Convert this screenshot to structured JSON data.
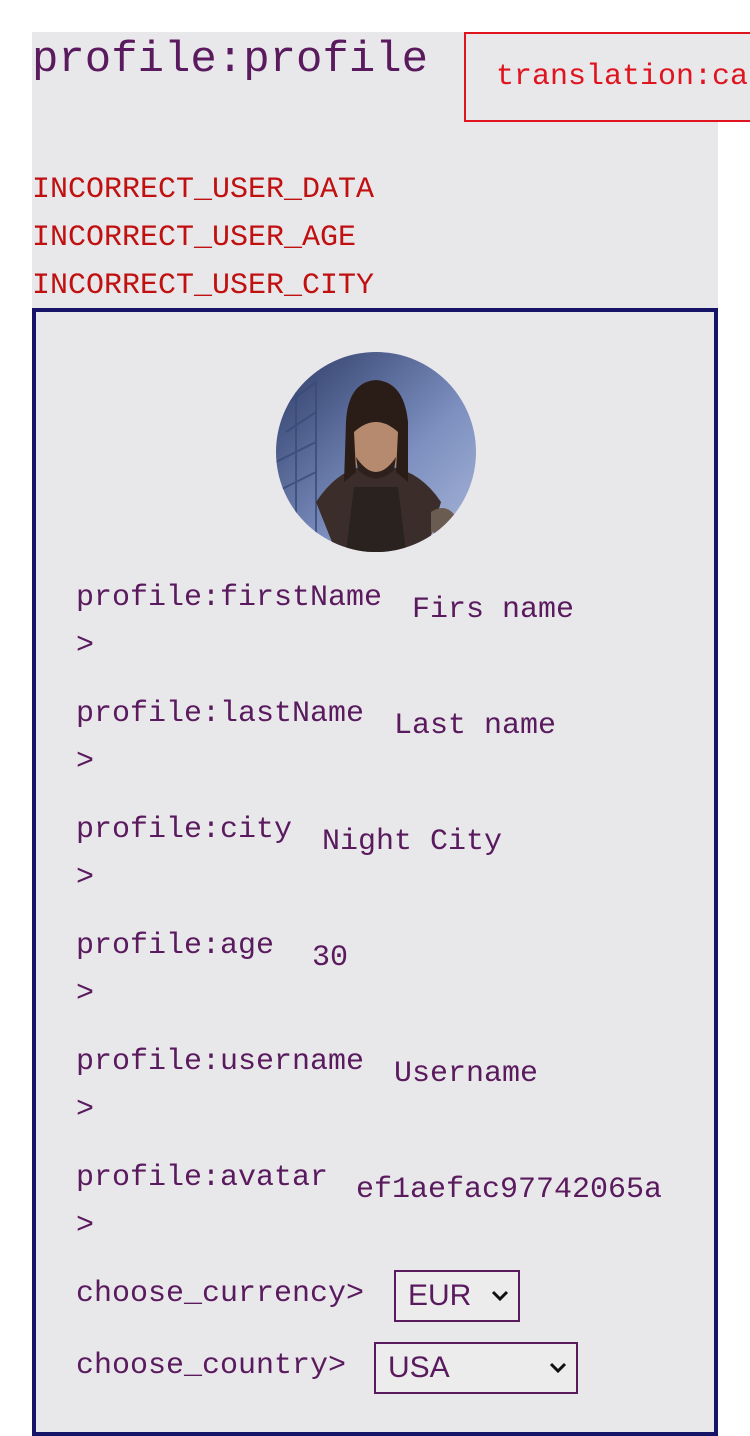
{
  "header": {
    "title": "profile:profile",
    "edit_button_label": "translation:cancel"
  },
  "errors": [
    "INCORRECT_USER_DATA",
    "INCORRECT_USER_AGE",
    "INCORRECT_USER_CITY"
  ],
  "form": {
    "fields": [
      {
        "label": "profile:firstName\n>",
        "value": "Firs name"
      },
      {
        "label": "profile:lastName\n>",
        "value": "Last name"
      },
      {
        "label": "profile:city\n>",
        "value": "Night City"
      },
      {
        "label": "profile:age\n>",
        "value": "30"
      },
      {
        "label": "profile:username\n>",
        "value": "Username"
      },
      {
        "label": "profile:avatar\n>",
        "value": "ef1aefac97742065a"
      }
    ],
    "currency": {
      "label": "choose_currency>",
      "value": "EUR"
    },
    "country": {
      "label": "choose_country>",
      "value": "USA"
    }
  },
  "colors": {
    "text": "#5a1a5e",
    "error": "#c01010",
    "button": "#e0141e",
    "card_border": "#161466",
    "background": "#e8e7ea"
  }
}
